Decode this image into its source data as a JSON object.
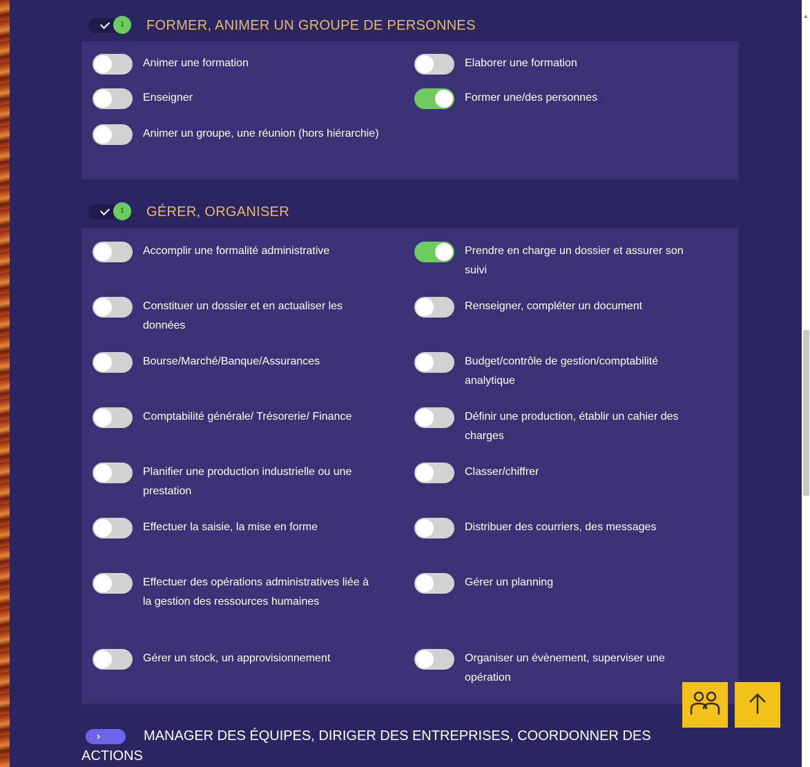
{
  "sections": [
    {
      "title": "FORMER, ANIMER UN GROUPE DE PERSONNES",
      "count": "1",
      "items": [
        {
          "label": "Animer une formation",
          "on": false
        },
        {
          "label": "Elaborer une formation",
          "on": false
        },
        {
          "label": "Enseigner",
          "on": false
        },
        {
          "label": "Former une/des personnes",
          "on": true
        },
        {
          "label": "Animer un groupe, une réunion (hors hiérarchie)",
          "on": false
        }
      ]
    },
    {
      "title": "GÉRER, ORGANISER",
      "count": "1",
      "items": [
        {
          "label": "Accomplir une formalité administrative",
          "on": false
        },
        {
          "label": "Prendre en charge un dossier et assurer son suivi",
          "on": true
        },
        {
          "label": "Constituer un dossier et en actualiser les données",
          "on": false
        },
        {
          "label": "Renseigner, compléter un document",
          "on": false
        },
        {
          "label": "Bourse/Marché/Banque/Assurances",
          "on": false
        },
        {
          "label": "Budget/contrôle de gestion/comptabilité analytique",
          "on": false
        },
        {
          "label": "Comptabilité générale/ Trésorerie/ Finance",
          "on": false
        },
        {
          "label": "Définir une production, établir un cahier des charges",
          "on": false
        },
        {
          "label": "Planifier une production industrielle ou une prestation",
          "on": false
        },
        {
          "label": "Classer/chiffrer",
          "on": false
        },
        {
          "label": "Effectuer la saisie, la mise en forme",
          "on": false
        },
        {
          "label": "Distribuer des courriers, des messages",
          "on": false
        },
        {
          "label": "Effectuer des opérations administratives liée à la gestion des ressources humaines",
          "on": false
        },
        {
          "label": "Gérer un planning",
          "on": false
        },
        {
          "label": "Gérer un stock, un approvisionnement",
          "on": false
        },
        {
          "label": "Organiser un évènement, superviser une opération",
          "on": false
        }
      ]
    },
    {
      "title_line1": "MANAGER DES ÉQUIPES, DIRIGER DES ENTREPRISES, COORDONNER DES",
      "title_line2": "ACTIONS"
    }
  ],
  "buttons": {
    "people_icon": "people-icon",
    "up_icon": "arrow-up-icon"
  },
  "colors": {
    "background": "#2b2562",
    "panel": "#3a3274",
    "accent_title": "#e8b96a",
    "switch_on": "#6ecc5f",
    "switch_off": "#d2d2d2",
    "fab": "#f2c21b"
  }
}
